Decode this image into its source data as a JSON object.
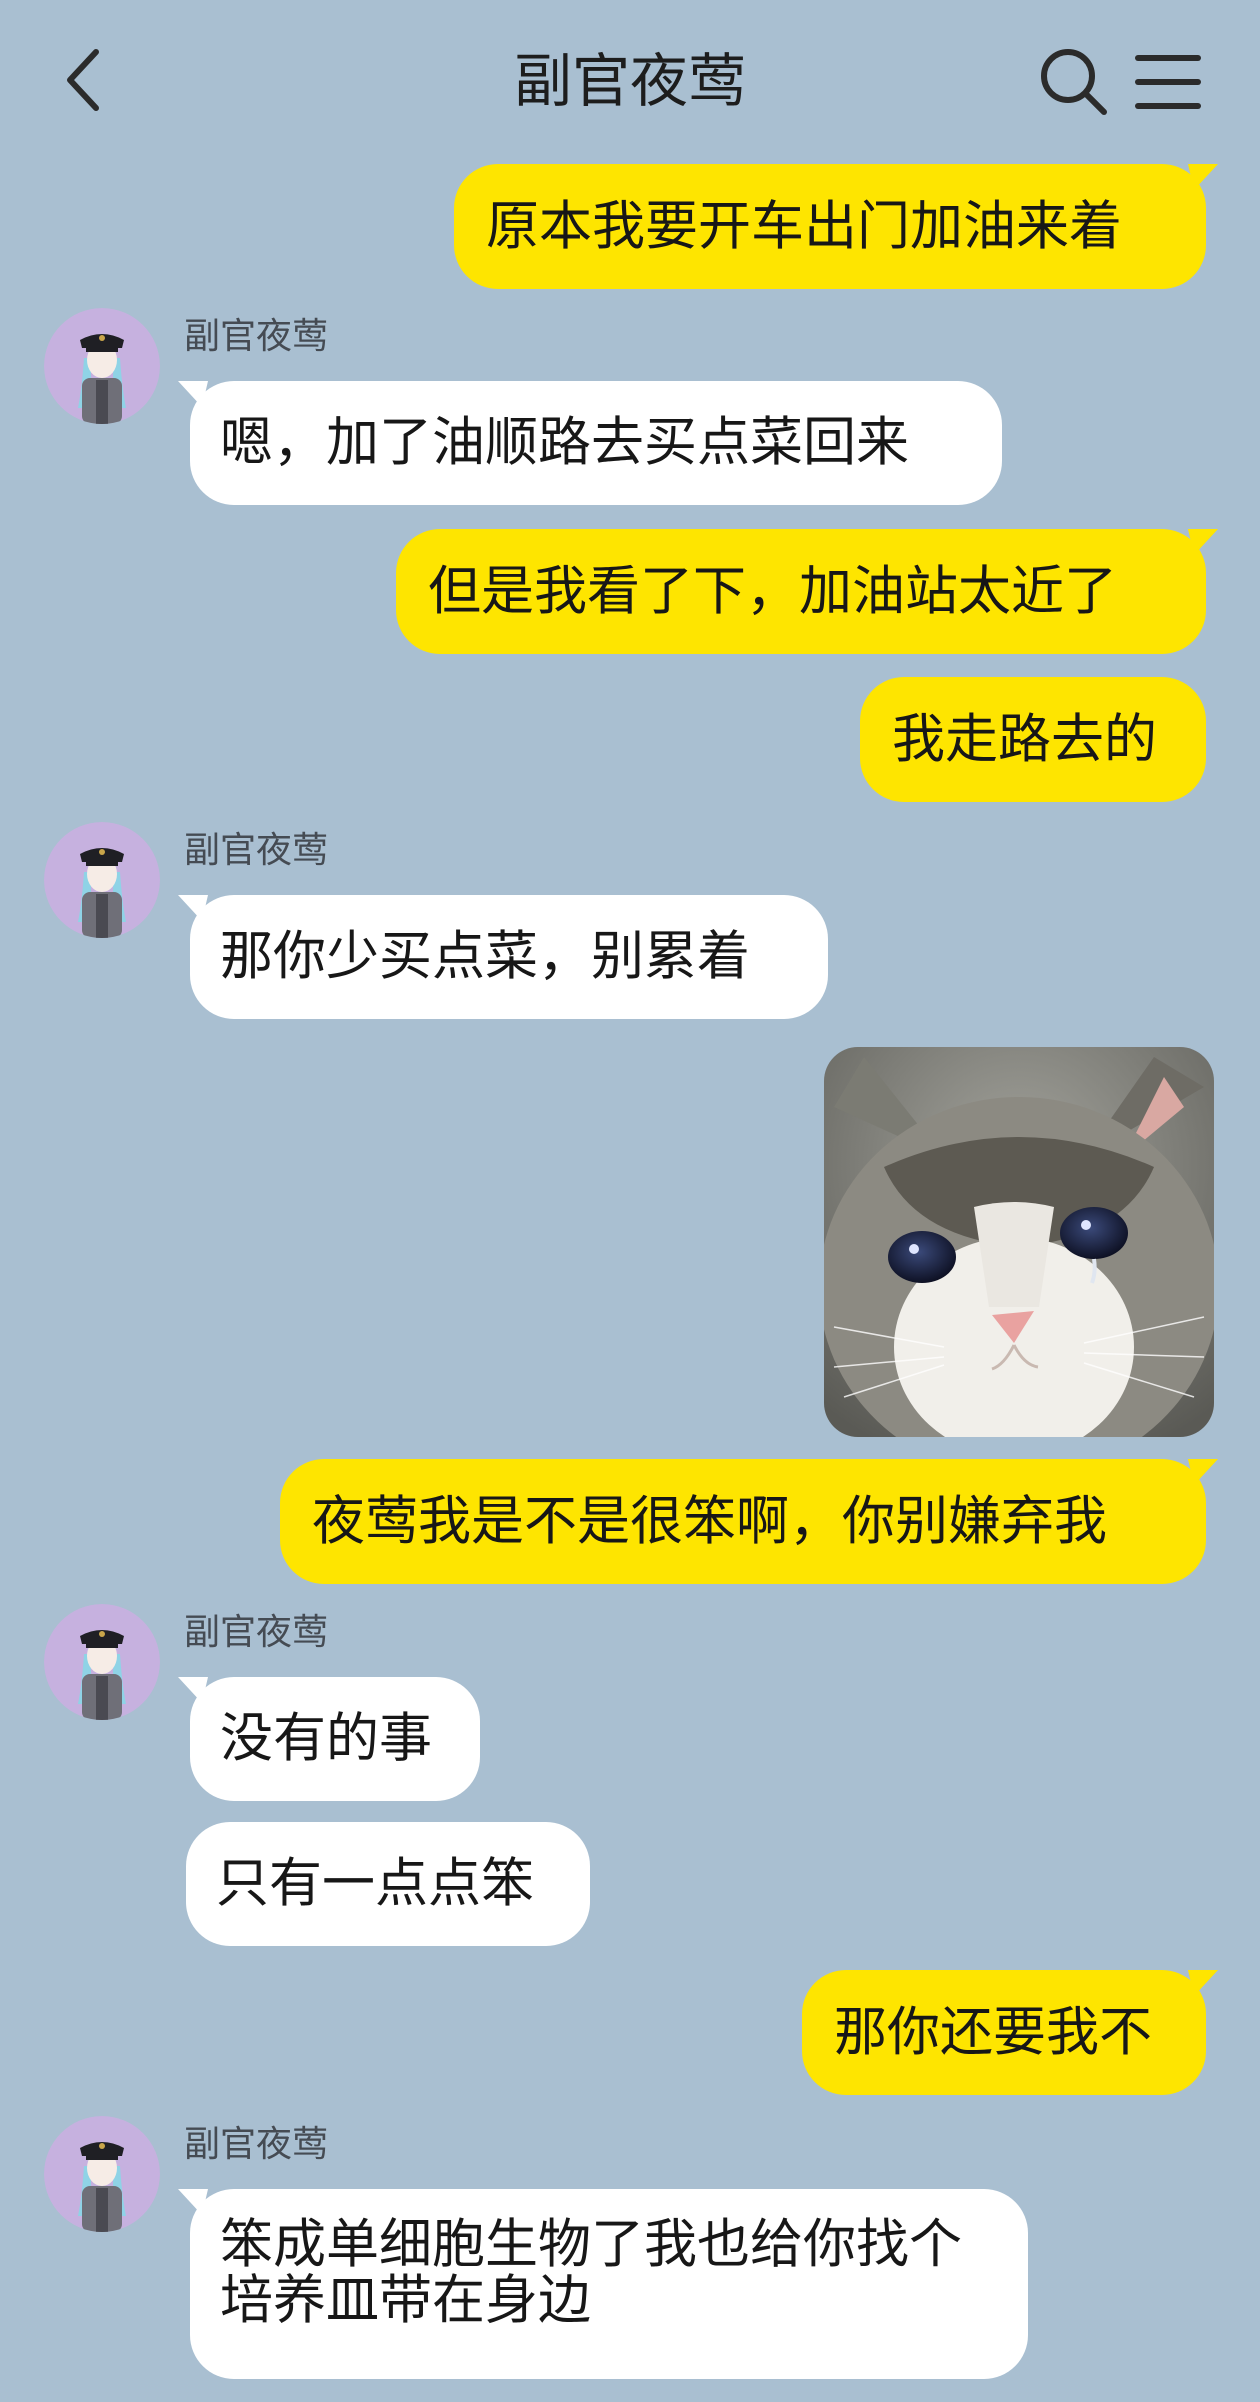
{
  "colors": {
    "background": "#a9bfd1",
    "my_bubble": "#fee500",
    "their_bubble": "#ffffff",
    "avatar_background": "#c6b1df"
  },
  "header": {
    "title": "副官夜莺",
    "back_icon": "chevron-left-icon",
    "search_icon": "search-icon",
    "menu_icon": "menu-icon"
  },
  "messages": [
    {
      "from": "me",
      "text": "原本我要开车出门加油来着"
    },
    {
      "from": "them",
      "sender": "副官夜莺",
      "text": "嗯，加了油顺路去买点菜回来"
    },
    {
      "from": "me",
      "text": "但是我看了下，加油站太近了"
    },
    {
      "from": "me",
      "text": "我走路去的"
    },
    {
      "from": "them",
      "sender": "副官夜莺",
      "text": "那你少买点菜，别累着"
    },
    {
      "from": "me",
      "type": "image",
      "image": "crying-cat-photo"
    },
    {
      "from": "me",
      "text": "夜莺我是不是很笨啊，你别嫌弃我"
    },
    {
      "from": "them",
      "sender": "副官夜莺",
      "text": "没有的事"
    },
    {
      "from": "them",
      "text": "只有一点点笨"
    },
    {
      "from": "me",
      "text": "那你还要我不"
    },
    {
      "from": "them",
      "sender": "副官夜莺",
      "text": "笨成单细胞生物了我也给你找个培养皿带在身边"
    }
  ]
}
